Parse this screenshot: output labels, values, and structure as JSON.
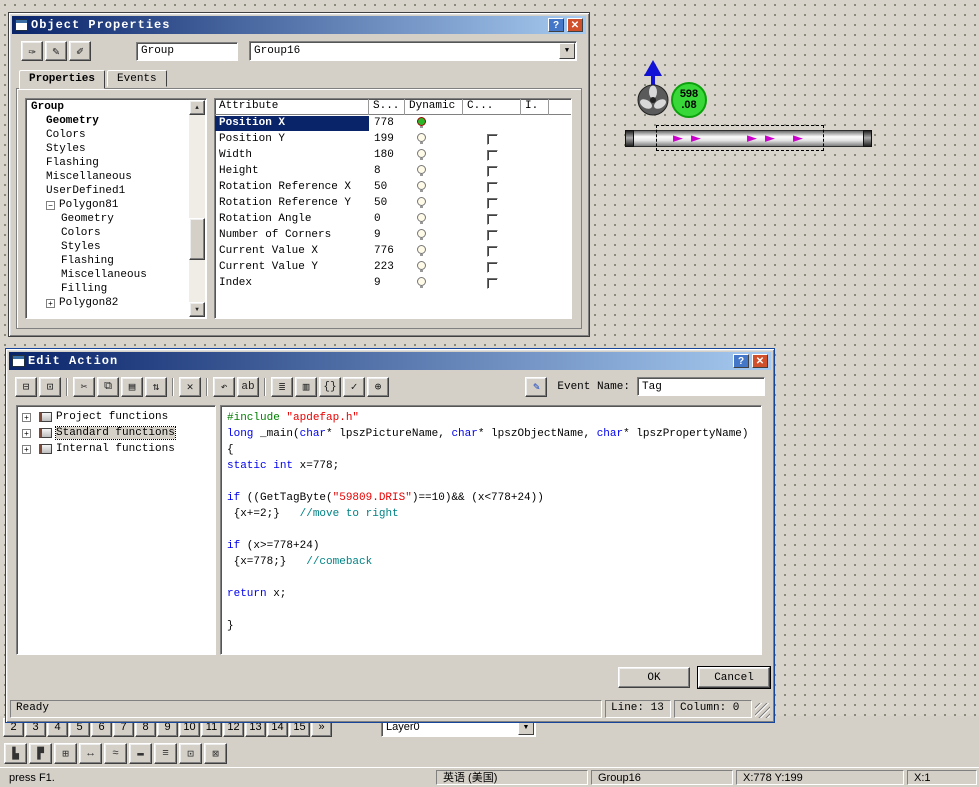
{
  "object_properties": {
    "title": "Object Properties",
    "titlebar": {
      "help": "?",
      "close": "✕"
    },
    "toolbar": {
      "buttons": [
        {
          "name": "dynamic-wizard-icon",
          "glyph": "✑"
        },
        {
          "name": "pen-blue-icon",
          "glyph": "✎"
        },
        {
          "name": "pen-yellow-icon",
          "glyph": "✐"
        }
      ],
      "object_type": "Group",
      "object_name": "Group16"
    },
    "tabs": [
      {
        "label": "Properties",
        "active": true
      },
      {
        "label": "Events",
        "active": false
      }
    ],
    "tree": [
      {
        "label": "Group",
        "level": 0,
        "bold": true,
        "box": null
      },
      {
        "label": "Geometry",
        "level": 1,
        "bold": true,
        "box": null
      },
      {
        "label": "Colors",
        "level": 1,
        "bold": false,
        "box": null
      },
      {
        "label": "Styles",
        "level": 1,
        "bold": false,
        "box": null
      },
      {
        "label": "Flashing",
        "level": 1,
        "bold": false,
        "box": null
      },
      {
        "label": "Miscellaneous",
        "level": 1,
        "bold": false,
        "box": null
      },
      {
        "label": "UserDefined1",
        "level": 1,
        "bold": false,
        "box": null
      },
      {
        "label": "Polygon81",
        "level": 1,
        "bold": false,
        "box": "minus"
      },
      {
        "label": "Geometry",
        "level": 2,
        "bold": false,
        "box": null
      },
      {
        "label": "Colors",
        "level": 2,
        "bold": false,
        "box": null
      },
      {
        "label": "Styles",
        "level": 2,
        "bold": false,
        "box": null
      },
      {
        "label": "Flashing",
        "level": 2,
        "bold": false,
        "box": null
      },
      {
        "label": "Miscellaneous",
        "level": 2,
        "bold": false,
        "box": null
      },
      {
        "label": "Filling",
        "level": 2,
        "bold": false,
        "box": null
      },
      {
        "label": "Polygon82",
        "level": 1,
        "bold": false,
        "box": "plus"
      }
    ],
    "table": {
      "columns": [
        "Attribute",
        "S...",
        "Dynamic",
        "C...",
        "I."
      ],
      "rows": [
        {
          "attribute": "Position X",
          "value": "778",
          "selected": true,
          "dynamic": true,
          "checkbox": false
        },
        {
          "attribute": "Position Y",
          "value": "199",
          "selected": false,
          "dynamic": false,
          "checkbox": true
        },
        {
          "attribute": "Width",
          "value": "180",
          "selected": false,
          "dynamic": false,
          "checkbox": true
        },
        {
          "attribute": "Height",
          "value": "8",
          "selected": false,
          "dynamic": false,
          "checkbox": true
        },
        {
          "attribute": "Rotation Reference X",
          "value": "50",
          "selected": false,
          "dynamic": false,
          "checkbox": true
        },
        {
          "attribute": "Rotation Reference Y",
          "value": "50",
          "selected": false,
          "dynamic": false,
          "checkbox": true
        },
        {
          "attribute": "Rotation Angle",
          "value": "0",
          "selected": false,
          "dynamic": false,
          "checkbox": true
        },
        {
          "attribute": "Number of Corners",
          "value": "9",
          "selected": false,
          "dynamic": false,
          "checkbox": true
        },
        {
          "attribute": "Current Value X",
          "value": "776",
          "selected": false,
          "dynamic": false,
          "checkbox": true
        },
        {
          "attribute": "Current Value Y",
          "value": "223",
          "selected": false,
          "dynamic": false,
          "checkbox": true
        },
        {
          "attribute": "Index",
          "value": "9",
          "selected": false,
          "dynamic": false,
          "checkbox": true
        }
      ]
    }
  },
  "edit_action": {
    "title": "Edit Action",
    "titlebar": {
      "help": "?",
      "close": "✕"
    },
    "toolbar": {
      "groups": [
        [
          {
            "name": "print-icon",
            "glyph": "⊟"
          },
          {
            "name": "print-preview-icon",
            "glyph": "⊡"
          }
        ],
        [
          {
            "name": "cut-icon",
            "glyph": "✂"
          },
          {
            "name": "copy-icon",
            "glyph": "⧉"
          },
          {
            "name": "paste-icon",
            "glyph": "▤"
          },
          {
            "name": "sort-icon",
            "glyph": "⇅"
          }
        ],
        [
          {
            "name": "delete-icon",
            "glyph": "✕"
          }
        ],
        [
          {
            "name": "undo-icon",
            "glyph": "↶"
          },
          {
            "name": "font-check-icon",
            "glyph": "ab"
          }
        ],
        [
          {
            "name": "check-list-icon",
            "glyph": "≣"
          },
          {
            "name": "function-browser-icon",
            "glyph": "▥"
          },
          {
            "name": "insert-brace-icon",
            "glyph": "{}"
          },
          {
            "name": "compile-icon",
            "glyph": "✓"
          },
          {
            "name": "target-icon",
            "glyph": "⊕"
          }
        ]
      ],
      "apply_button": {
        "name": "trigger-icon",
        "glyph": "✎"
      },
      "event_name_label": "Event Name:",
      "event_name_value": "Tag"
    },
    "functions_tree": [
      {
        "label": "Project functions",
        "selected": false
      },
      {
        "label": "Standard functions",
        "selected": true
      },
      {
        "label": "Internal functions",
        "selected": false
      }
    ],
    "code": {
      "lines": [
        [
          {
            "t": "#include ",
            "c": "pre"
          },
          {
            "t": "\"apdefap.h\"",
            "c": "str"
          }
        ],
        [
          {
            "t": "long",
            "c": "kw"
          },
          {
            "t": " _main(",
            "c": "n"
          },
          {
            "t": "char",
            "c": "kw"
          },
          {
            "t": "* lpszPictureName, ",
            "c": "n"
          },
          {
            "t": "char",
            "c": "kw"
          },
          {
            "t": "* lpszObjectName, ",
            "c": "n"
          },
          {
            "t": "char",
            "c": "kw"
          },
          {
            "t": "* lpszPropertyName)",
            "c": "n"
          }
        ],
        [
          {
            "t": "{",
            "c": "n"
          }
        ],
        [
          {
            "t": "static",
            "c": "kw"
          },
          {
            "t": " ",
            "c": "n"
          },
          {
            "t": "int",
            "c": "kw"
          },
          {
            "t": " x=778;",
            "c": "n"
          }
        ],
        [],
        [
          {
            "t": "if",
            "c": "kw"
          },
          {
            "t": " ((GetTagByte(",
            "c": "n"
          },
          {
            "t": "\"59809.DRIS\"",
            "c": "str"
          },
          {
            "t": ")==10)&& (x<778+24))",
            "c": "n"
          }
        ],
        [
          {
            "t": " {x+=2;}   ",
            "c": "n"
          },
          {
            "t": "//move to right",
            "c": "com"
          }
        ],
        [],
        [
          {
            "t": "if",
            "c": "kw"
          },
          {
            "t": " (x>=778+24)",
            "c": "n"
          }
        ],
        [
          {
            "t": " {x=778;}   ",
            "c": "n"
          },
          {
            "t": "//comeback",
            "c": "com"
          }
        ],
        [],
        [
          {
            "t": "return",
            "c": "kw"
          },
          {
            "t": " x;",
            "c": "n"
          }
        ],
        [],
        [
          {
            "t": "}",
            "c": "n"
          }
        ]
      ]
    },
    "buttons": {
      "ok": "OK",
      "cancel": "Cancel"
    },
    "statusbar": {
      "ready": "Ready",
      "line": "Line: 13",
      "column": "Column: 0"
    }
  },
  "canvas": {
    "gauge": {
      "value_top": "598",
      "value_bottom": ".08",
      "color": "#38d838"
    },
    "pipe_arrow_color": "#cc00cc"
  },
  "layer_toolbar": {
    "buttons": [
      "2",
      "3",
      "4",
      "5",
      "6",
      "7",
      "8",
      "9",
      "10",
      "11",
      "12",
      "13",
      "14",
      "15",
      "»"
    ],
    "layer_select": "Layer0"
  },
  "bottom_toolbar": {
    "buttons": [
      {
        "name": "chart-tool-icon",
        "glyph": "▙"
      },
      {
        "name": "stack-tool-icon",
        "glyph": "▛"
      },
      {
        "name": "grid-add-tool-icon",
        "glyph": "⊞"
      },
      {
        "name": "width-tool-icon",
        "glyph": "↔"
      },
      {
        "name": "curve-tool-icon",
        "glyph": "≈"
      },
      {
        "name": "pipe-tool-icon",
        "glyph": "▬"
      },
      {
        "name": "list-tool-icon",
        "glyph": "≡"
      },
      {
        "name": "snap-tool-icon",
        "glyph": "⊡"
      },
      {
        "name": "close-tool-icon",
        "glyph": "⊠"
      }
    ]
  },
  "app_statusbar": {
    "help": "press F1.",
    "language": "英语 (美国)",
    "object": "Group16",
    "coords": "X:778 Y:199",
    "coords2": "X:1"
  }
}
